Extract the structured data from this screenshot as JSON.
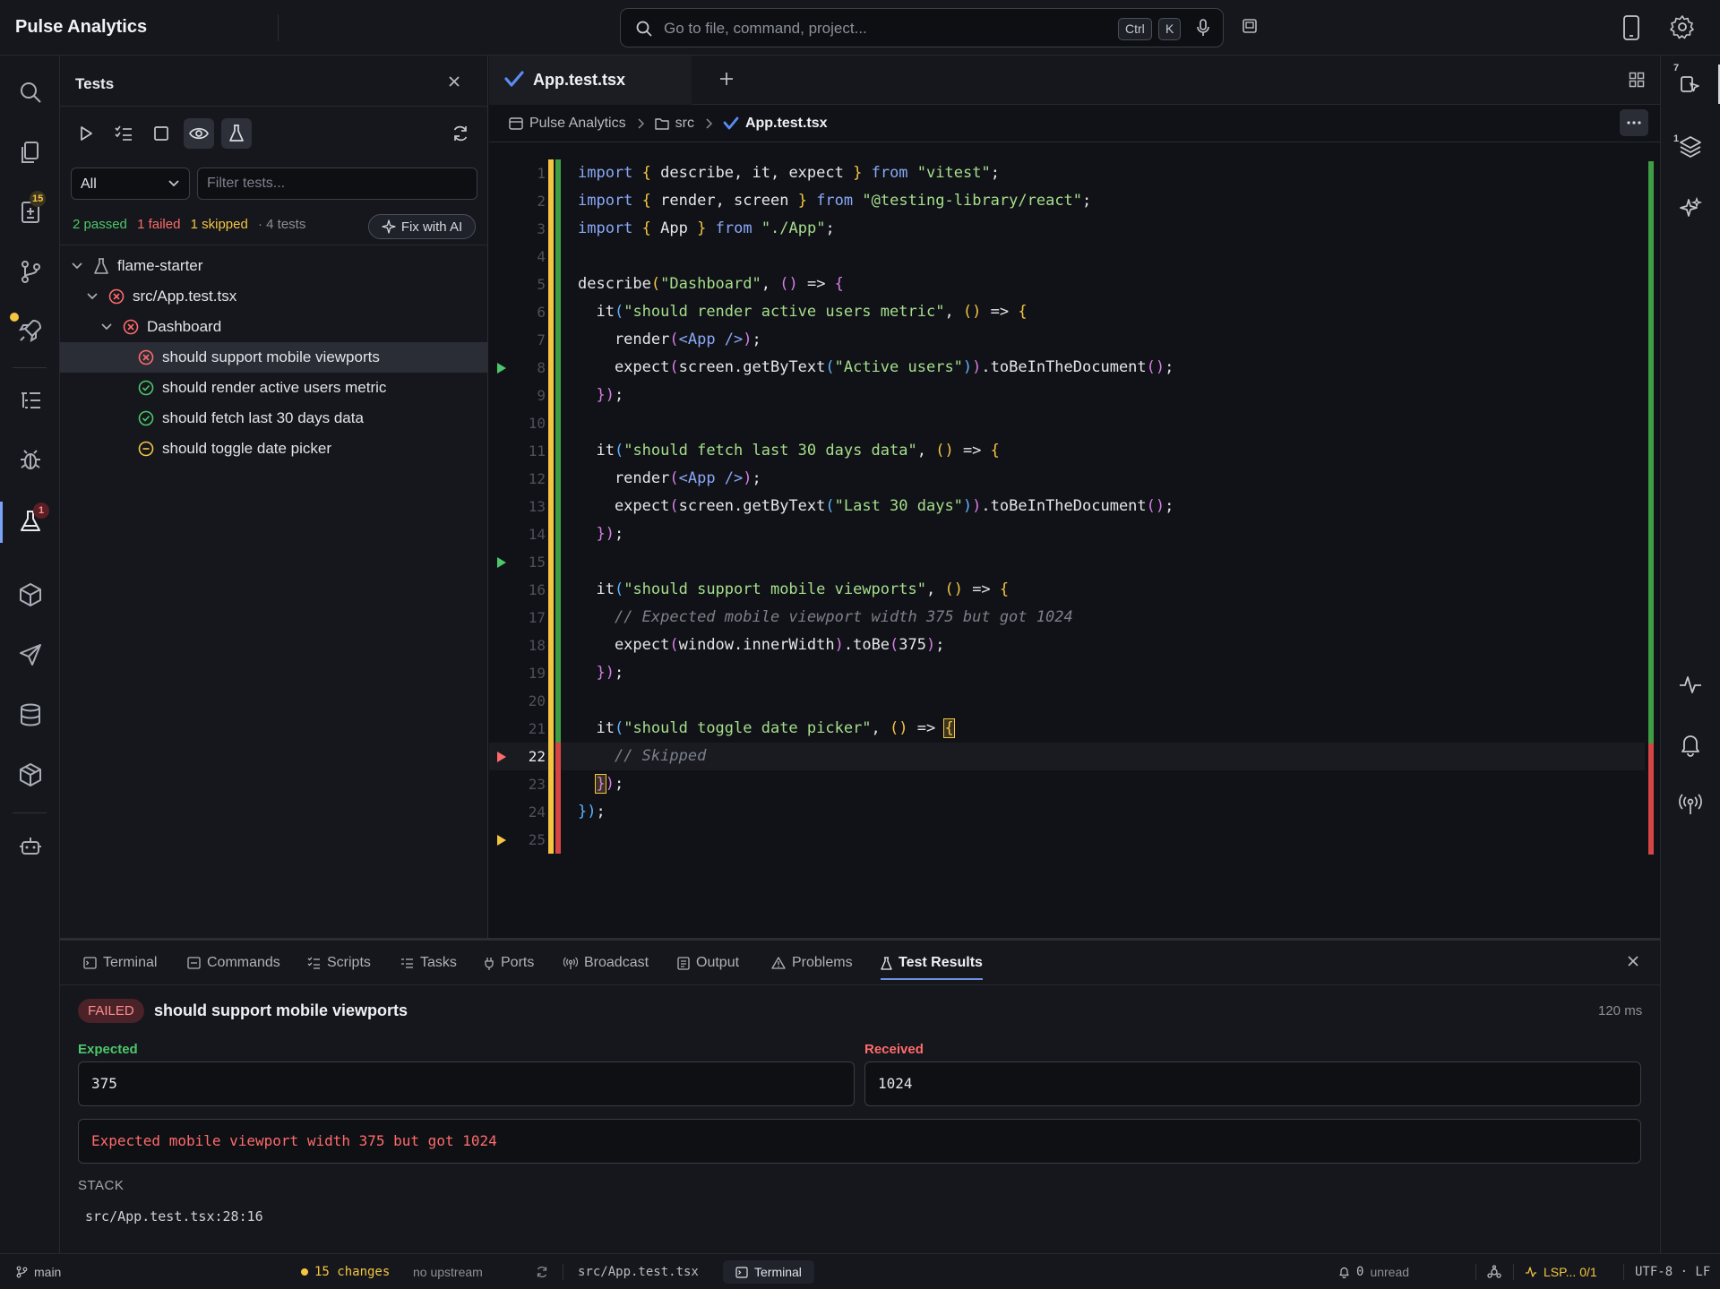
{
  "app": {
    "title": "Pulse Analytics"
  },
  "command_bar": {
    "placeholder": "Go to file, command, project...",
    "kbd_ctrl": "Ctrl",
    "kbd_k": "K"
  },
  "activity_badges": {
    "changes": "15",
    "tests": "1"
  },
  "right_badges": {
    "top": "7",
    "layers": "1"
  },
  "tests_panel": {
    "title": "Tests",
    "filter_value": "All",
    "filter_placeholder": "Filter tests...",
    "summary": {
      "passed": "2 passed",
      "failed": "1 failed",
      "skipped": "1 skipped",
      "total": "· 4 tests"
    },
    "fix_ai": "Fix with AI",
    "tree": {
      "project": "flame-starter",
      "file": "src/App.test.tsx",
      "suite": "Dashboard",
      "tests": [
        {
          "name": "should support mobile viewports",
          "status": "failed"
        },
        {
          "name": "should render active users metric",
          "status": "passed"
        },
        {
          "name": "should fetch last 30 days data",
          "status": "passed"
        },
        {
          "name": "should toggle date picker",
          "status": "skipped"
        }
      ]
    }
  },
  "editor": {
    "tab": "App.test.tsx",
    "breadcrumb": [
      "Pulse Analytics",
      "src",
      "App.test.tsx"
    ],
    "lines": [
      "import { describe, it, expect } from \"vitest\";",
      "import { render, screen } from \"@testing-library/react\";",
      "import { App } from \"./App\";",
      "",
      "describe(\"Dashboard\", () => {",
      "  it(\"should render active users metric\", () => {",
      "    render(<App />);",
      "    expect(screen.getByText(\"Active users\")).toBeInTheDocument();",
      "  });",
      "",
      "  it(\"should fetch last 30 days data\", () => {",
      "    render(<App />);",
      "    expect(screen.getByText(\"Last 30 days\")).toBeInTheDocument();",
      "  });",
      "",
      "  it(\"should support mobile viewports\", () => {",
      "    // Expected mobile viewport width 375 but got 1024",
      "    expect(window.innerWidth).toBe(375);",
      "  });",
      "",
      "  it(\"should toggle date picker\", () => {",
      "    // Skipped",
      "  });",
      "});",
      ""
    ],
    "current_line": 22
  },
  "bottom_panel": {
    "tabs": [
      "Terminal",
      "Commands",
      "Scripts",
      "Tasks",
      "Ports",
      "Broadcast",
      "Output",
      "Problems",
      "Test Results"
    ],
    "active_tab": "Test Results",
    "result": {
      "status": "FAILED",
      "name": "should support mobile viewports",
      "duration": "120 ms",
      "expected_label": "Expected",
      "expected": "375",
      "received_label": "Received",
      "received": "1024",
      "message": "Expected mobile viewport width 375 but got 1024",
      "stack_label": "STACK",
      "stack": "src/App.test.tsx:28:16"
    }
  },
  "status_bar": {
    "branch": "main",
    "changes": "15 changes",
    "upstream": "no upstream",
    "file": "src/App.test.tsx",
    "terminal": "Terminal",
    "unread_count": "0",
    "unread_label": "unread",
    "lsp": "LSP... 0/1",
    "encoding": "UTF-8 · LF"
  },
  "colors": {
    "passed": "#4cc76a",
    "failed": "#ff6b6b",
    "skipped": "#f5c542",
    "accent": "#7aa2f7"
  }
}
